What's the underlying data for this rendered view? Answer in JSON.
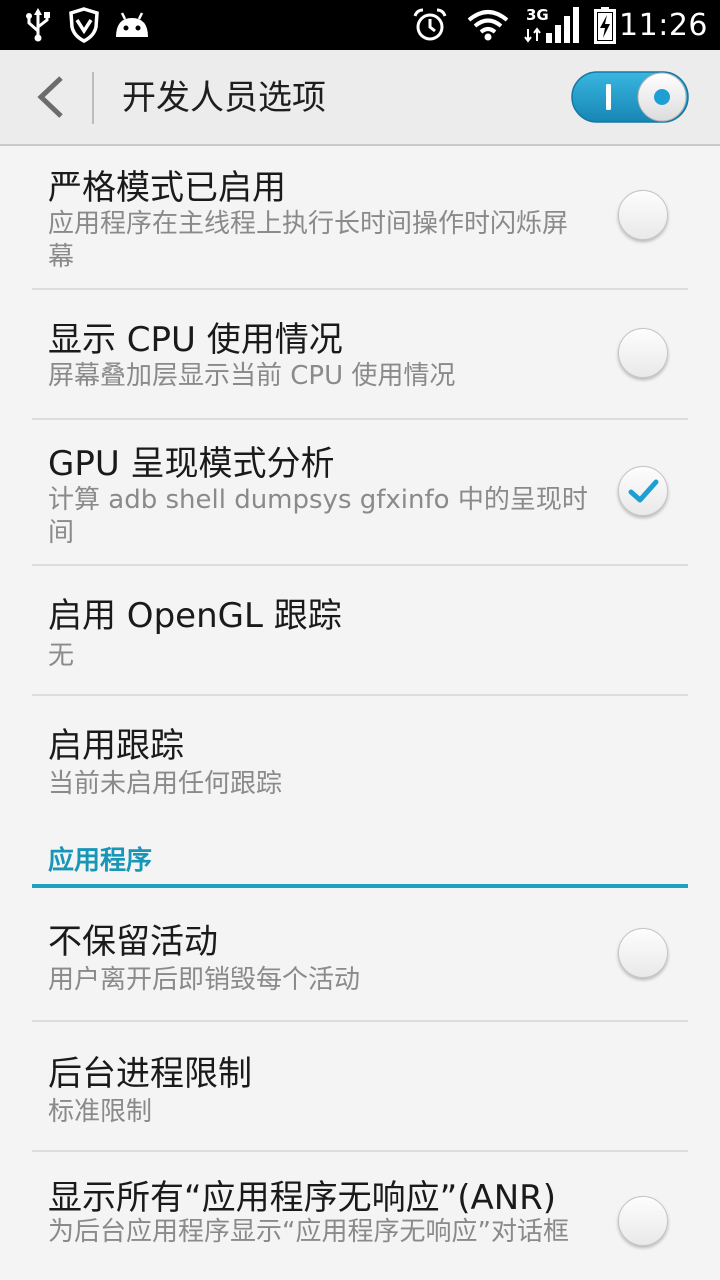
{
  "status_bar": {
    "time": "11:26",
    "network_label": "3G",
    "icons": [
      "usb-icon",
      "shield-icon",
      "android-icon",
      "alarm-icon",
      "wifi-icon",
      "signal-icon",
      "battery-charging-icon"
    ]
  },
  "header": {
    "title": "开发人员选项",
    "master_switch": {
      "state": "on"
    },
    "accent": "#1fa1c6"
  },
  "items": [
    {
      "title": "严格模式已启用",
      "summary": "应用程序在主线程上执行长时间操作时闪烁屏幕",
      "checkbox": false
    },
    {
      "title": "显示 CPU 使用情况",
      "summary": "屏幕叠加层显示当前 CPU 使用情况",
      "checkbox": false
    },
    {
      "title": "GPU 呈现模式分析",
      "summary": "计算 adb shell dumpsys gfxinfo 中的呈现时间",
      "checkbox": true
    },
    {
      "title": "启用 OpenGL 跟踪",
      "summary": "无"
    },
    {
      "title": "启用跟踪",
      "summary": "当前未启用任何跟踪"
    }
  ],
  "section": {
    "label": "应用程序"
  },
  "app_items": [
    {
      "title": "不保留活动",
      "summary": "用户离开后即销毁每个活动",
      "checkbox": false
    },
    {
      "title": "后台进程限制",
      "summary": "标准限制"
    },
    {
      "title": "显示所有“应用程序无响应”(ANR)",
      "summary": "为后台应用程序显示“应用程序无响应”对话框",
      "checkbox": false
    }
  ]
}
